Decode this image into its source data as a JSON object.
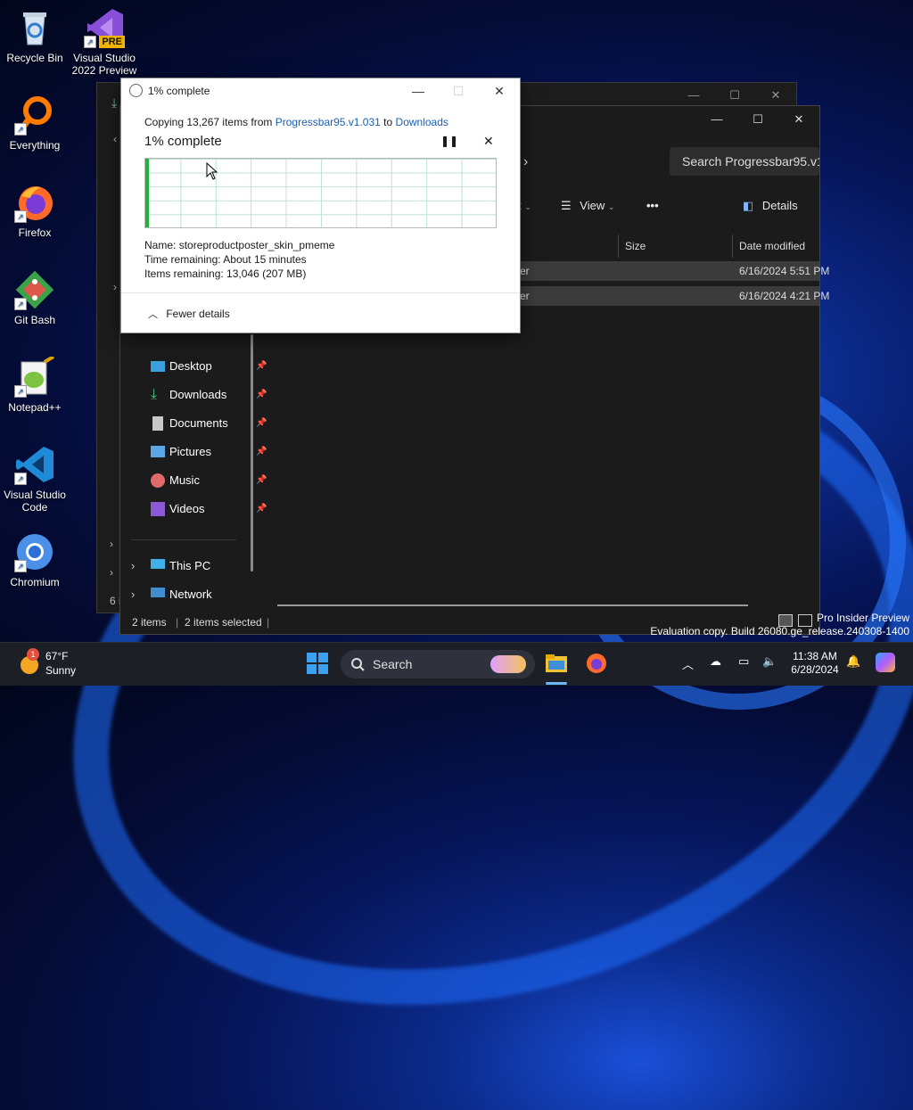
{
  "desktop": {
    "icons": [
      {
        "label": "Recycle Bin"
      },
      {
        "label": "Visual Studio 2022 Preview",
        "badge": "PRE"
      },
      {
        "label": "Everything"
      },
      {
        "label": "Firefox"
      },
      {
        "label": "Git Bash"
      },
      {
        "label": "Notepad++"
      },
      {
        "label": "Visual Studio Code"
      },
      {
        "label": "Chromium"
      }
    ]
  },
  "explorer": {
    "search_placeholder": "Search Progressbar95.v1.",
    "toolbar": {
      "sort_partial": "t",
      "view": "View",
      "more": "•••",
      "details": "Details"
    },
    "columns": {
      "size": "Size",
      "date_modified": "Date modified"
    },
    "rows": [
      {
        "type_partial": "er",
        "date": "6/16/2024 5:51 PM"
      },
      {
        "type_partial": "er",
        "date": "6/16/2024 4:21 PM"
      }
    ],
    "quick_access": [
      {
        "label": "Desktop"
      },
      {
        "label": "Downloads"
      },
      {
        "label": "Documents"
      },
      {
        "label": "Pictures"
      },
      {
        "label": "Music"
      },
      {
        "label": "Videos"
      }
    ],
    "this_pc": "This PC",
    "network": "Network",
    "status": {
      "items": "2 items",
      "selected": "2 items selected"
    },
    "back_status_partial": "6 i"
  },
  "copy_dialog": {
    "window_title": "1% complete",
    "copying_prefix": "Copying 13,267 items from",
    "source": "Progressbar95.v1.031",
    "to_word": "to",
    "destination": "Downloads",
    "headline": "1% complete",
    "progress_percent": 1,
    "name_label": "Name:",
    "name_value": "storeproductposter_skin_pmeme",
    "time_label": "Time remaining:",
    "time_value": "About 15 minutes",
    "items_label": "Items remaining:",
    "items_value": "13,046 (207 MB)",
    "fewer_details": "Fewer details"
  },
  "taskbar": {
    "weather_temp": "67°F",
    "weather_cond": "Sunny",
    "weather_badge": "1",
    "search_label": "Search",
    "time": "11:38 AM",
    "date": "6/28/2024"
  },
  "watermark": {
    "line1": "Pro Insider Preview",
    "line2": "Evaluation copy. Build 26080.ge_release.240308-1400"
  },
  "colors": {
    "accent": "#1a5fb4",
    "progress": "#1fb33a"
  }
}
